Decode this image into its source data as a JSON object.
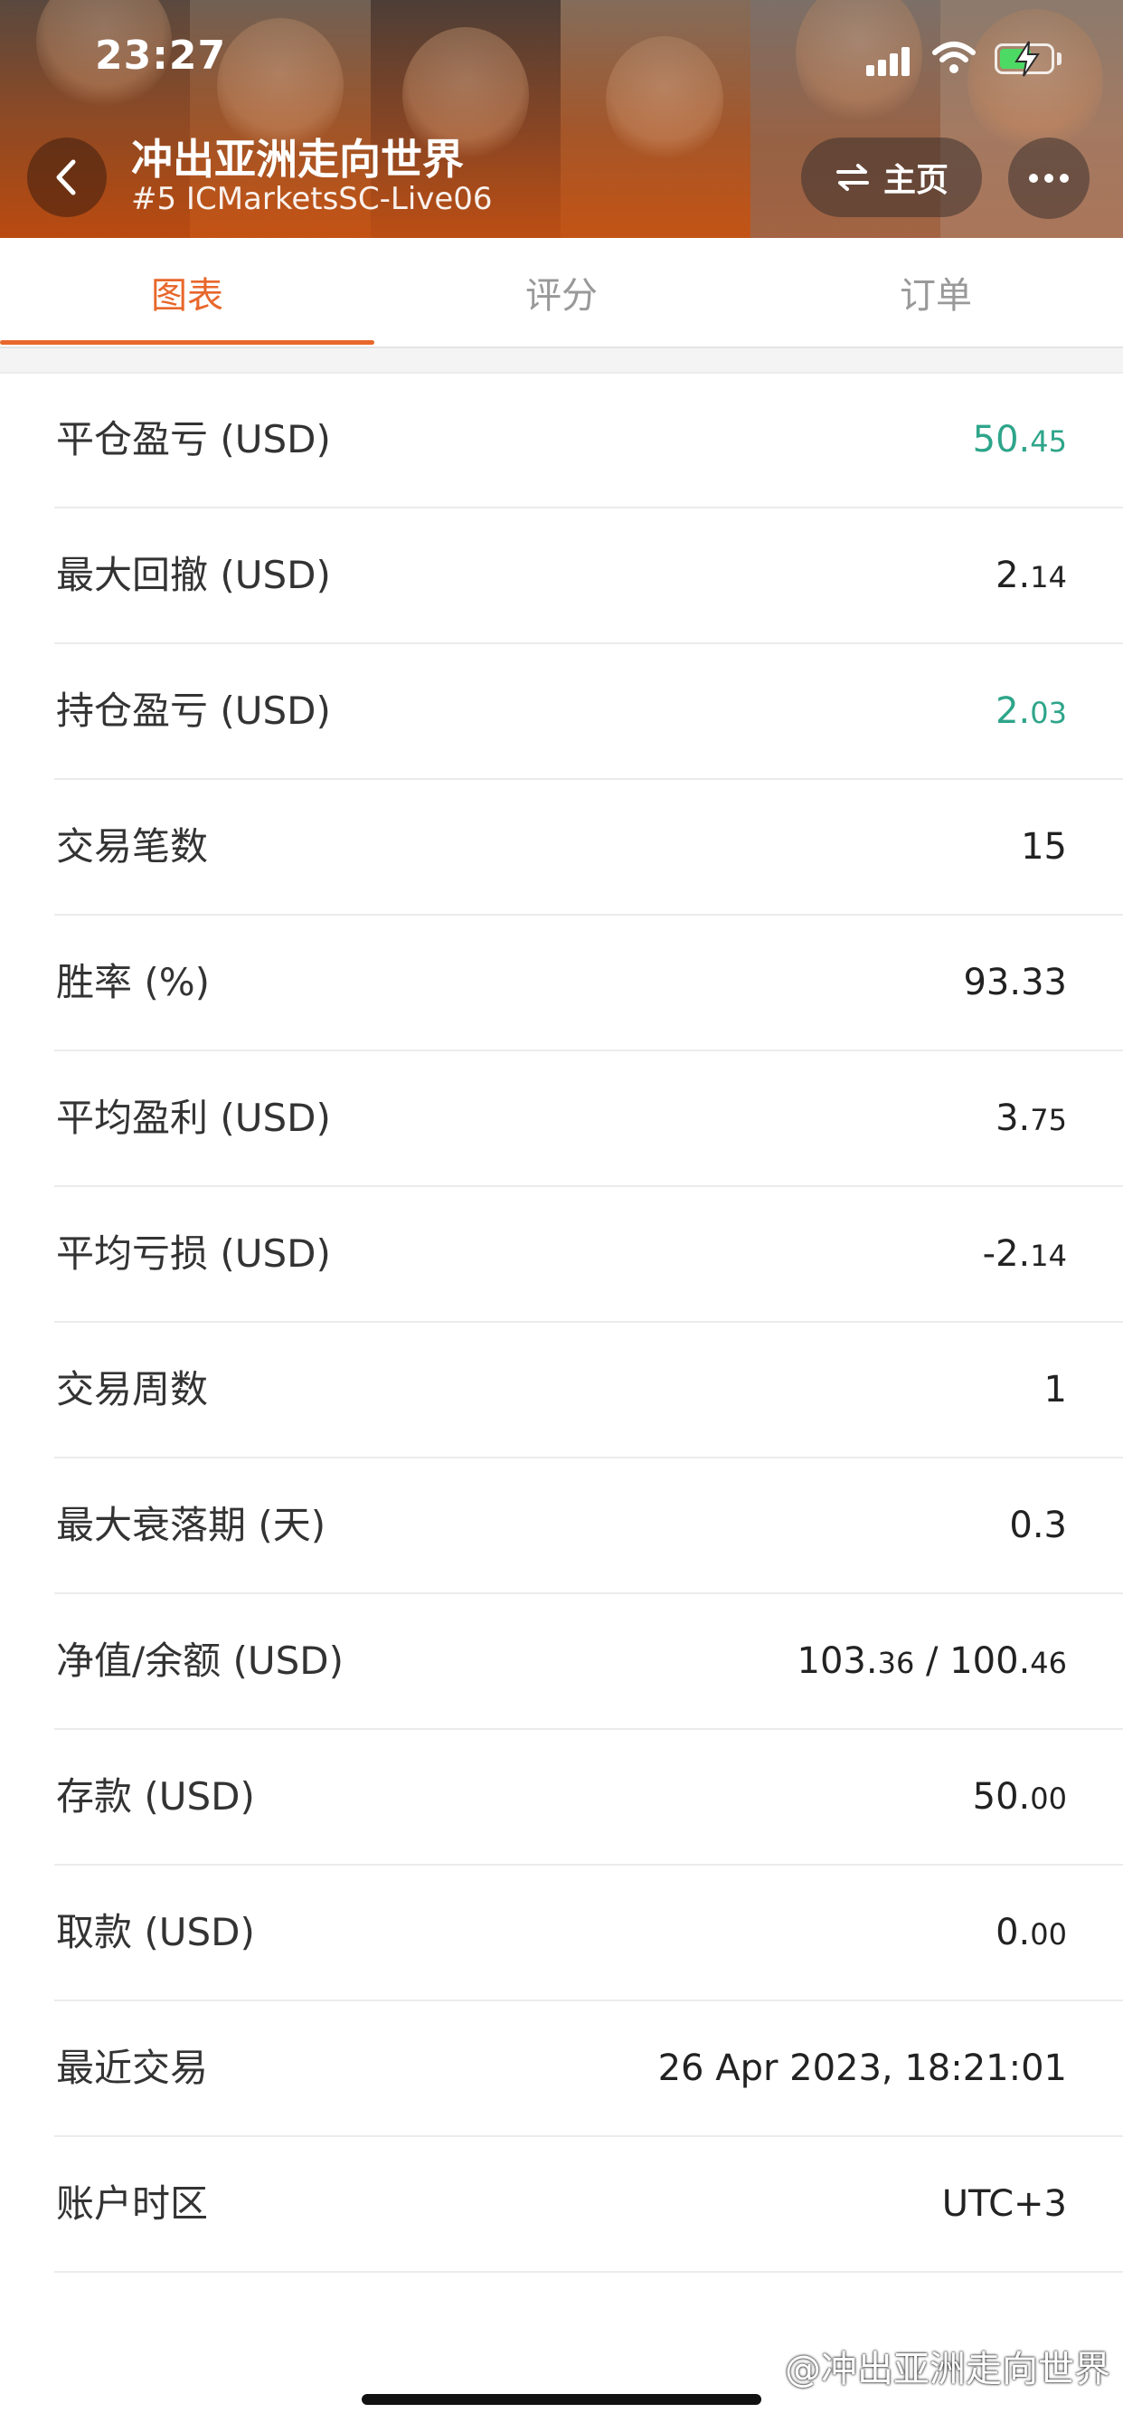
{
  "status_bar": {
    "time": "23:27"
  },
  "header": {
    "title": "冲出亚洲走向世界",
    "subtitle": "#5 ICMarketsSC-Live06",
    "home_label": "主页"
  },
  "tabs": [
    {
      "label": "图表",
      "active": true
    },
    {
      "label": "评分",
      "active": false
    },
    {
      "label": "订单",
      "active": false
    }
  ],
  "stats": [
    {
      "label": "平仓盈亏 (USD)",
      "int": "50.",
      "frac": "45",
      "color": "green"
    },
    {
      "label": "最大回撤 (USD)",
      "int": "2.",
      "frac": "14",
      "color": "default"
    },
    {
      "label": "持仓盈亏 (USD)",
      "int": "2.",
      "frac": "03",
      "color": "green"
    },
    {
      "label": "交易笔数",
      "int": "15",
      "frac": "",
      "color": "default"
    },
    {
      "label": "胜率 (%)",
      "int": "93.33",
      "frac": "",
      "color": "default"
    },
    {
      "label": "平均盈利 (USD)",
      "int": "3.",
      "frac": "75",
      "color": "default"
    },
    {
      "label": "平均亏损 (USD)",
      "int": "-2.",
      "frac": "14",
      "color": "default"
    },
    {
      "label": "交易周数",
      "int": "1",
      "frac": "",
      "color": "default"
    },
    {
      "label": "最大衰落期 (天)",
      "int": "0.3",
      "frac": "",
      "color": "default"
    },
    {
      "label": "净值/余额 (USD)",
      "int": "103.",
      "frac": "36",
      "int2": " / 100.",
      "frac2": "46",
      "color": "default"
    },
    {
      "label": "存款 (USD)",
      "int": "50.",
      "frac": "00",
      "color": "default"
    },
    {
      "label": "取款 (USD)",
      "int": "0.",
      "frac": "00",
      "color": "default"
    },
    {
      "label": "最近交易",
      "int": "26 Apr 2023, 18:21:01",
      "frac": "",
      "color": "default"
    },
    {
      "label": "账户时区",
      "int": "UTC+3",
      "frac": "",
      "color": "default"
    }
  ],
  "watermark": "@冲出亚洲走向世界",
  "colors": {
    "accent": "#e8672b",
    "positive": "#2ea58a",
    "header_bg": "#b84a12"
  },
  "icons": [
    "back-chevron-icon",
    "swap-arrows-icon",
    "more-dots-icon",
    "signal-icon",
    "wifi-icon",
    "battery-charging-icon"
  ]
}
